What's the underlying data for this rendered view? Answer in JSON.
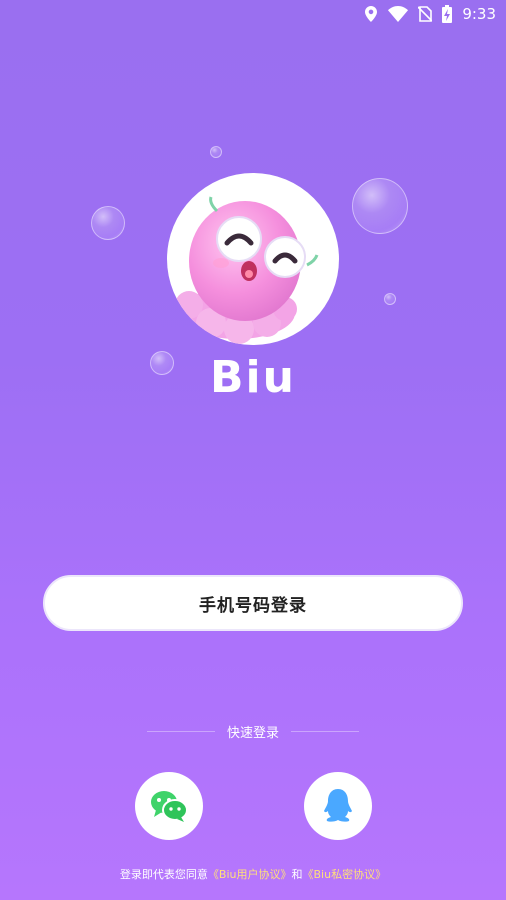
{
  "status_bar": {
    "time": "9:33",
    "icons": [
      "location-icon",
      "wifi-icon",
      "no-sim-icon",
      "battery-charging-icon"
    ]
  },
  "app": {
    "name": "Biu",
    "logo_icon": "octopus-mascot-icon"
  },
  "login": {
    "phone_button_label": "手机号码登录",
    "quick_login_label": "快速登录",
    "social": [
      {
        "name": "wechat",
        "icon": "wechat-icon",
        "color": "#3fd36a"
      },
      {
        "name": "qq",
        "icon": "qq-icon",
        "color": "#4aa8ff"
      }
    ]
  },
  "agreement": {
    "prefix": "登录即代表您同意",
    "user_agreement": "《Biu用户协议》",
    "conjunction": "和",
    "privacy_agreement": "《Biu私密协议》"
  },
  "colors": {
    "background_top": "#9a6ff0",
    "background_bottom": "#b676fd",
    "link": "#ffe07a"
  }
}
